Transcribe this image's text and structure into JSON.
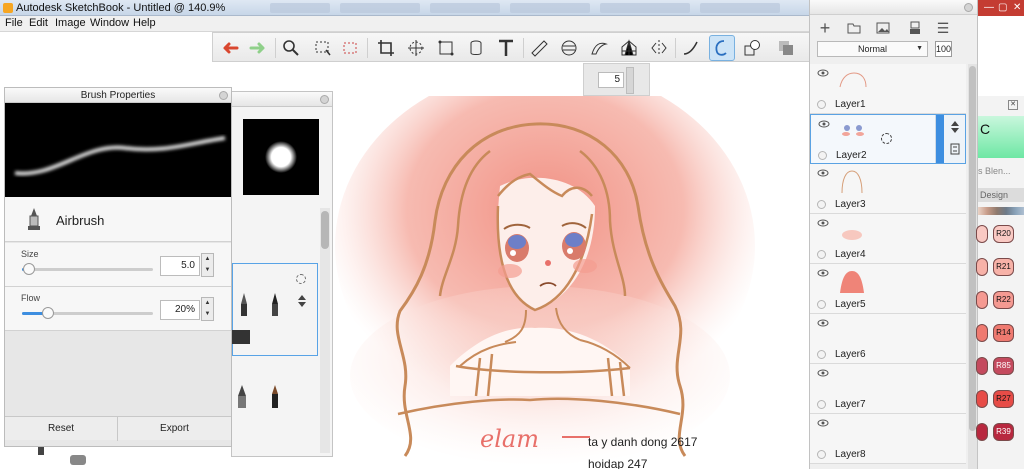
{
  "window": {
    "title": "Autodesk SketchBook - Untitled @ 140.9%"
  },
  "menu": [
    "File",
    "Edit",
    "Image",
    "Window",
    "Help"
  ],
  "toolbar": {
    "tools": [
      "undo",
      "redo",
      "zoom",
      "select",
      "lasso-select",
      "crop",
      "transform",
      "distort",
      "fill",
      "text",
      "ruler",
      "ellipse",
      "french-curve",
      "perspective",
      "symmetry",
      "stroke",
      "predictive-stroke",
      "copy"
    ],
    "active_tool": "predictive-stroke"
  },
  "mini_panel": {
    "value": "5"
  },
  "brush_properties": {
    "title": "Brush Properties",
    "brush_name": "Airbrush",
    "size_label": "Size",
    "size_value": "5.0",
    "size_fraction": 0.05,
    "flow_label": "Flow",
    "flow_value": "20%",
    "flow_fraction": 0.2,
    "reset_label": "Reset",
    "export_label": "Export"
  },
  "layer_editor": {
    "blend_mode": "Normal",
    "opacity": "100",
    "selected_layer": "Layer2",
    "layers": [
      {
        "name": "Layer1"
      },
      {
        "name": "Layer2"
      },
      {
        "name": "Layer3"
      },
      {
        "name": "Layer4"
      },
      {
        "name": "Layer5"
      },
      {
        "name": "Layer6"
      },
      {
        "name": "Layer7"
      },
      {
        "name": "Layer8"
      }
    ]
  },
  "color_panel": {
    "header_letter": "C",
    "text_blend": "s Blen...",
    "design_tab": "Design",
    "swatches": [
      {
        "label": "R20",
        "color": "#f9c9c3"
      },
      {
        "label": "R21",
        "color": "#f7b2a8"
      },
      {
        "label": "R22",
        "color": "#f59a92"
      },
      {
        "label": "R14",
        "color": "#ef7a70"
      },
      {
        "label": "R85",
        "color": "#c44a5e"
      },
      {
        "label": "R27",
        "color": "#e74c47"
      },
      {
        "label": "R39",
        "color": "#b8283f"
      }
    ]
  },
  "canvas": {
    "signature": "elam",
    "text_line_1": "ta y danh dong 2617",
    "text_line_2": "hoidap 247"
  }
}
